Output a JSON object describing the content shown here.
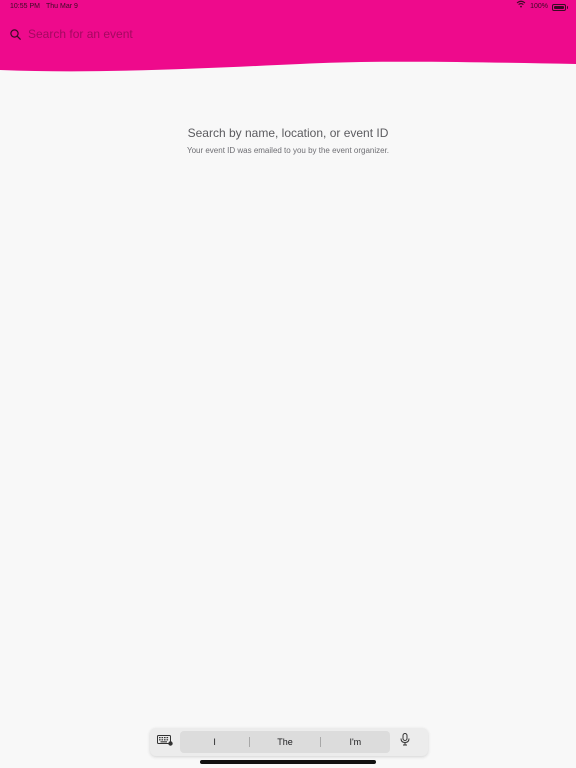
{
  "status_bar": {
    "time": "10:55 PM",
    "date": "Thu Mar 9",
    "battery": "100%"
  },
  "search": {
    "value": "",
    "placeholder": "Search for an event"
  },
  "empty_state": {
    "title": "Search by name, location, or event ID",
    "subtitle": "Your event ID was emailed to you by the event organizer."
  },
  "keyboard_bar": {
    "suggestions": [
      "I",
      "The",
      "I'm"
    ],
    "left_icon": "keyboard-icon",
    "right_icon": "microphone-icon"
  },
  "colors": {
    "header_pink": "#ee0a8c",
    "background": "#f8f8f8",
    "text_secondary": "#5b5b5f"
  }
}
